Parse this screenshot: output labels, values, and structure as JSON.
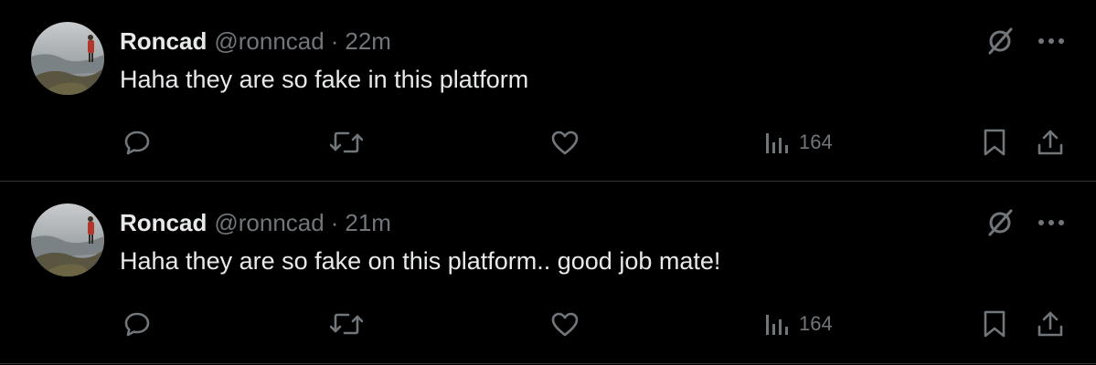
{
  "tweets": [
    {
      "author_name": "Roncad",
      "handle": "@ronncad",
      "separator": "·",
      "time": "22m",
      "text": "Haha they are so fake in this platform",
      "views": "164"
    },
    {
      "author_name": "Roncad",
      "handle": "@ronncad",
      "separator": "·",
      "time": "21m",
      "text": "Haha they are so fake on this platform.. good job mate!",
      "views": "164"
    }
  ],
  "icons": {
    "reply": "reply-icon",
    "repost": "repost-icon",
    "like": "like-icon",
    "views": "views-icon",
    "bookmark": "bookmark-icon",
    "share": "share-icon",
    "grok": "grok-icon",
    "more": "more-icon"
  },
  "colors": {
    "background": "#000000",
    "primary_text": "#e7e9ea",
    "secondary_text": "#71767b",
    "divider": "#2f3336"
  }
}
